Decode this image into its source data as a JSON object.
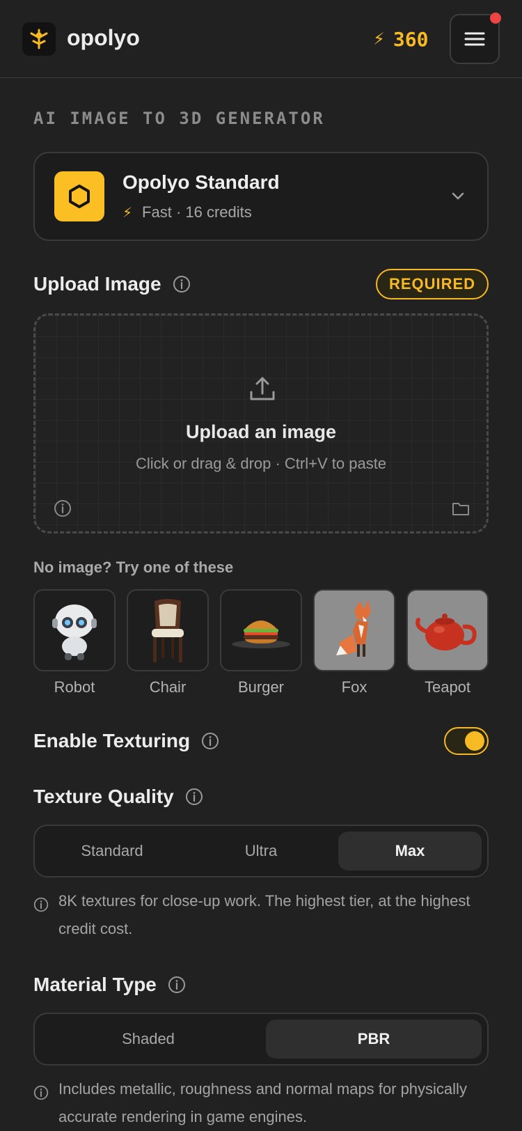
{
  "header": {
    "brand": "opolyo",
    "credits": "360",
    "icons": [
      "opolyo-logo-icon",
      "bolt-icon",
      "menu-icon",
      "notification-dot"
    ],
    "colors": {
      "accent": "#f7b924",
      "notification": "#ef4444",
      "background": "#212121"
    }
  },
  "page": {
    "section_title": "AI IMAGE TO 3D GENERATOR"
  },
  "model": {
    "name": "Opolyo Standard",
    "meta": "Fast · 16 credits",
    "icon": "hexagon-icon"
  },
  "upload": {
    "label": "Upload Image",
    "required_badge": "REQUIRED",
    "title": "Upload an image",
    "subtitle": "Click or drag & drop · Ctrl+V to paste"
  },
  "samples": {
    "label": "No image? Try one of these",
    "items": [
      {
        "label": "Robot"
      },
      {
        "label": "Chair"
      },
      {
        "label": "Burger"
      },
      {
        "label": "Fox"
      },
      {
        "label": "Teapot"
      }
    ]
  },
  "texturing": {
    "label": "Enable Texturing",
    "enabled": true
  },
  "texture_quality": {
    "label": "Texture Quality",
    "options": [
      "Standard",
      "Ultra",
      "Max"
    ],
    "selected": "Max",
    "note": "8K textures for close-up work. The highest tier, at the highest credit cost."
  },
  "material": {
    "label": "Material Type",
    "options": [
      "Shaded",
      "PBR"
    ],
    "selected": "PBR",
    "note": "Includes metallic, roughness and normal maps for physically accurate rendering in game engines."
  }
}
